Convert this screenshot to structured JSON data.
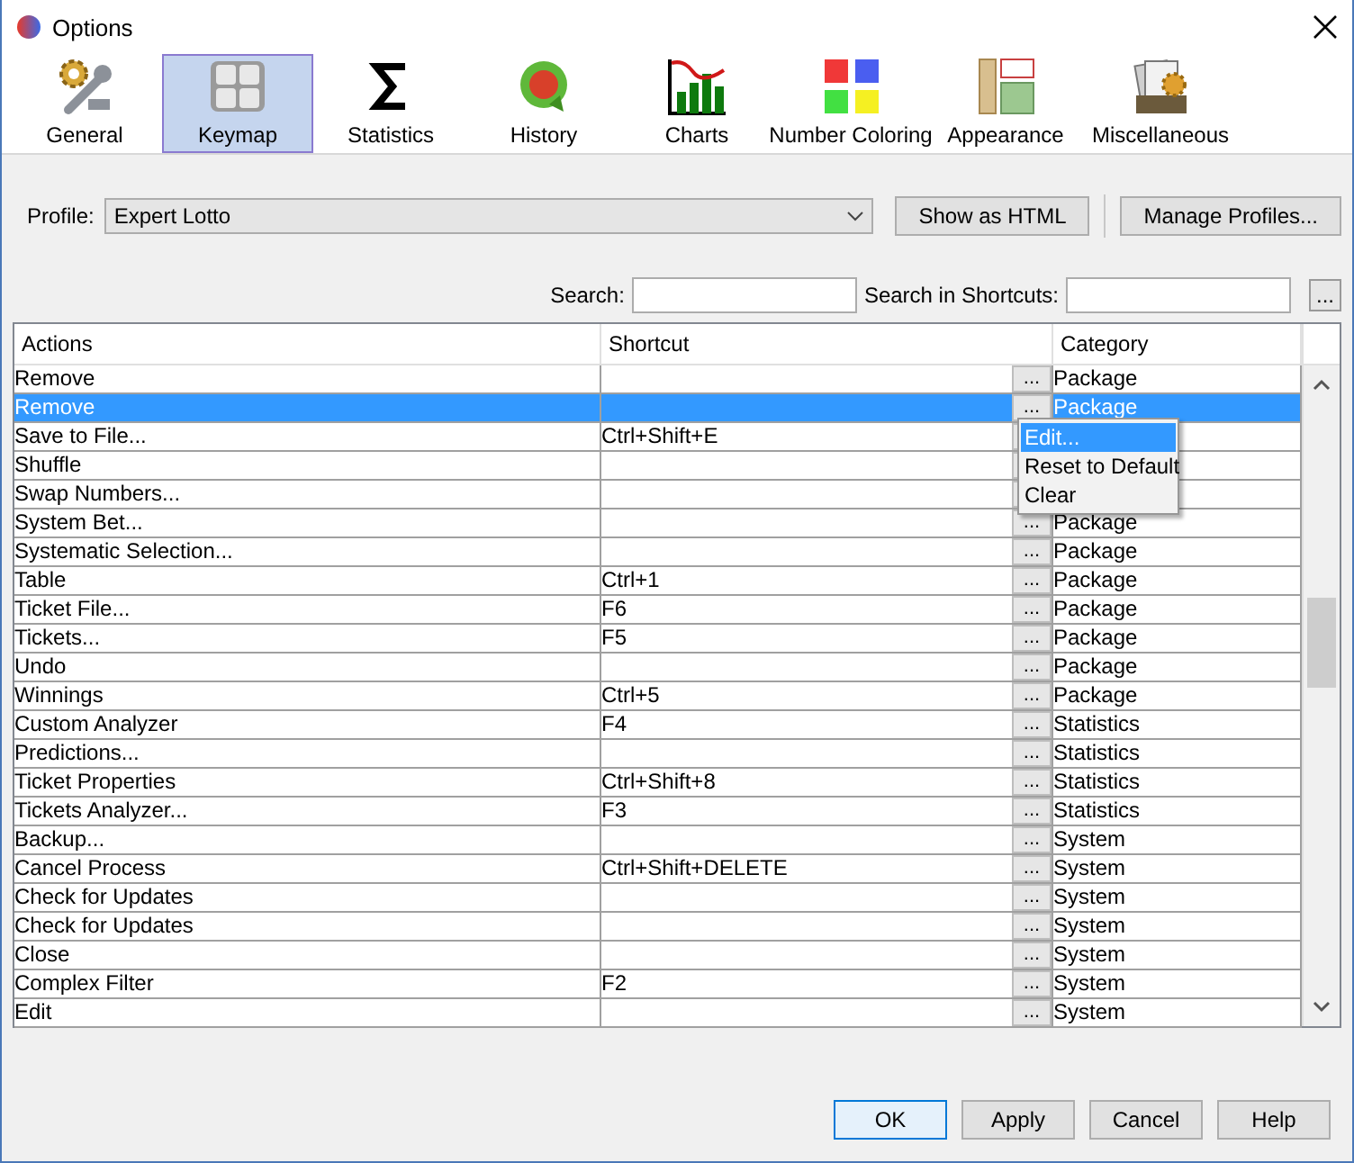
{
  "window": {
    "title": "Options"
  },
  "tabs": [
    {
      "label": "General",
      "selected": false
    },
    {
      "label": "Keymap",
      "selected": true
    },
    {
      "label": "Statistics",
      "selected": false
    },
    {
      "label": "History",
      "selected": false
    },
    {
      "label": "Charts",
      "selected": false
    },
    {
      "label": "Number Coloring",
      "selected": false
    },
    {
      "label": "Appearance",
      "selected": false
    },
    {
      "label": "Miscellaneous",
      "selected": false
    }
  ],
  "profile": {
    "label": "Profile:",
    "value": "Expert Lotto",
    "buttons": [
      "Show as HTML",
      "Manage Profiles..."
    ]
  },
  "search": {
    "label": "Search:",
    "shortcuts_label": "Search in Shortcuts:",
    "button": "..."
  },
  "table": {
    "columns": [
      "Actions",
      "Shortcut",
      "Category"
    ],
    "rows": [
      {
        "action": "Remove",
        "shortcut": "",
        "button": "...",
        "category": "Package",
        "selected": false
      },
      {
        "action": "Remove",
        "shortcut": "",
        "button": "...",
        "category": "Package",
        "selected": true
      },
      {
        "action": "Save to File...",
        "shortcut": "Ctrl+Shift+E",
        "selected": false
      },
      {
        "action": "Shuffle",
        "shortcut": "",
        "selected": false
      },
      {
        "action": "Swap Numbers...",
        "shortcut": "",
        "selected": false
      },
      {
        "action": "System Bet...",
        "shortcut": "",
        "button": "...",
        "category": "Package",
        "selected": false
      },
      {
        "action": "Systematic Selection...",
        "shortcut": "",
        "button": "...",
        "category": "Package",
        "selected": false
      },
      {
        "action": "Table",
        "shortcut": "Ctrl+1",
        "button": "...",
        "category": "Package",
        "selected": false
      },
      {
        "action": "Ticket File...",
        "shortcut": "F6",
        "button": "...",
        "category": "Package",
        "selected": false
      },
      {
        "action": "Tickets...",
        "shortcut": "F5",
        "button": "...",
        "category": "Package",
        "selected": false
      },
      {
        "action": "Undo",
        "shortcut": "",
        "button": "...",
        "category": "Package",
        "selected": false
      },
      {
        "action": "Winnings",
        "shortcut": "Ctrl+5",
        "button": "...",
        "category": "Package",
        "selected": false
      },
      {
        "action": "Custom Analyzer",
        "shortcut": "F4",
        "button": "...",
        "category": "Statistics",
        "selected": false
      },
      {
        "action": "Predictions...",
        "shortcut": "",
        "button": "...",
        "category": "Statistics",
        "selected": false
      },
      {
        "action": "Ticket Properties",
        "shortcut": "Ctrl+Shift+8",
        "button": "...",
        "category": "Statistics",
        "selected": false
      },
      {
        "action": "Tickets Analyzer...",
        "shortcut": "F3",
        "button": "...",
        "category": "Statistics",
        "selected": false
      },
      {
        "action": "Backup...",
        "shortcut": "",
        "button": "...",
        "category": "System",
        "selected": false
      },
      {
        "action": "Cancel Process",
        "shortcut": "Ctrl+Shift+DELETE",
        "button": "...",
        "category": "System",
        "selected": false
      },
      {
        "action": "Check for Updates",
        "shortcut": "",
        "button": "...",
        "category": "System",
        "selected": false
      },
      {
        "action": "Check for Updates",
        "shortcut": "",
        "button": "...",
        "category": "System",
        "selected": false
      },
      {
        "action": "Close",
        "shortcut": "",
        "button": "...",
        "category": "System",
        "selected": false
      },
      {
        "action": "Complex Filter",
        "shortcut": "F2",
        "button": "...",
        "category": "System",
        "selected": false
      },
      {
        "action": "Edit",
        "shortcut": "",
        "button": "...",
        "category": "System",
        "selected": false
      }
    ]
  },
  "context_menu": [
    {
      "label": "Edit...",
      "selected": true
    },
    {
      "label": "Reset to Default",
      "selected": false
    },
    {
      "label": "Clear",
      "selected": false
    }
  ],
  "buttons": [
    {
      "label": "OK",
      "default": true
    },
    {
      "label": "Apply",
      "default": false
    },
    {
      "label": "Cancel",
      "default": false
    },
    {
      "label": "Help",
      "default": false
    }
  ]
}
